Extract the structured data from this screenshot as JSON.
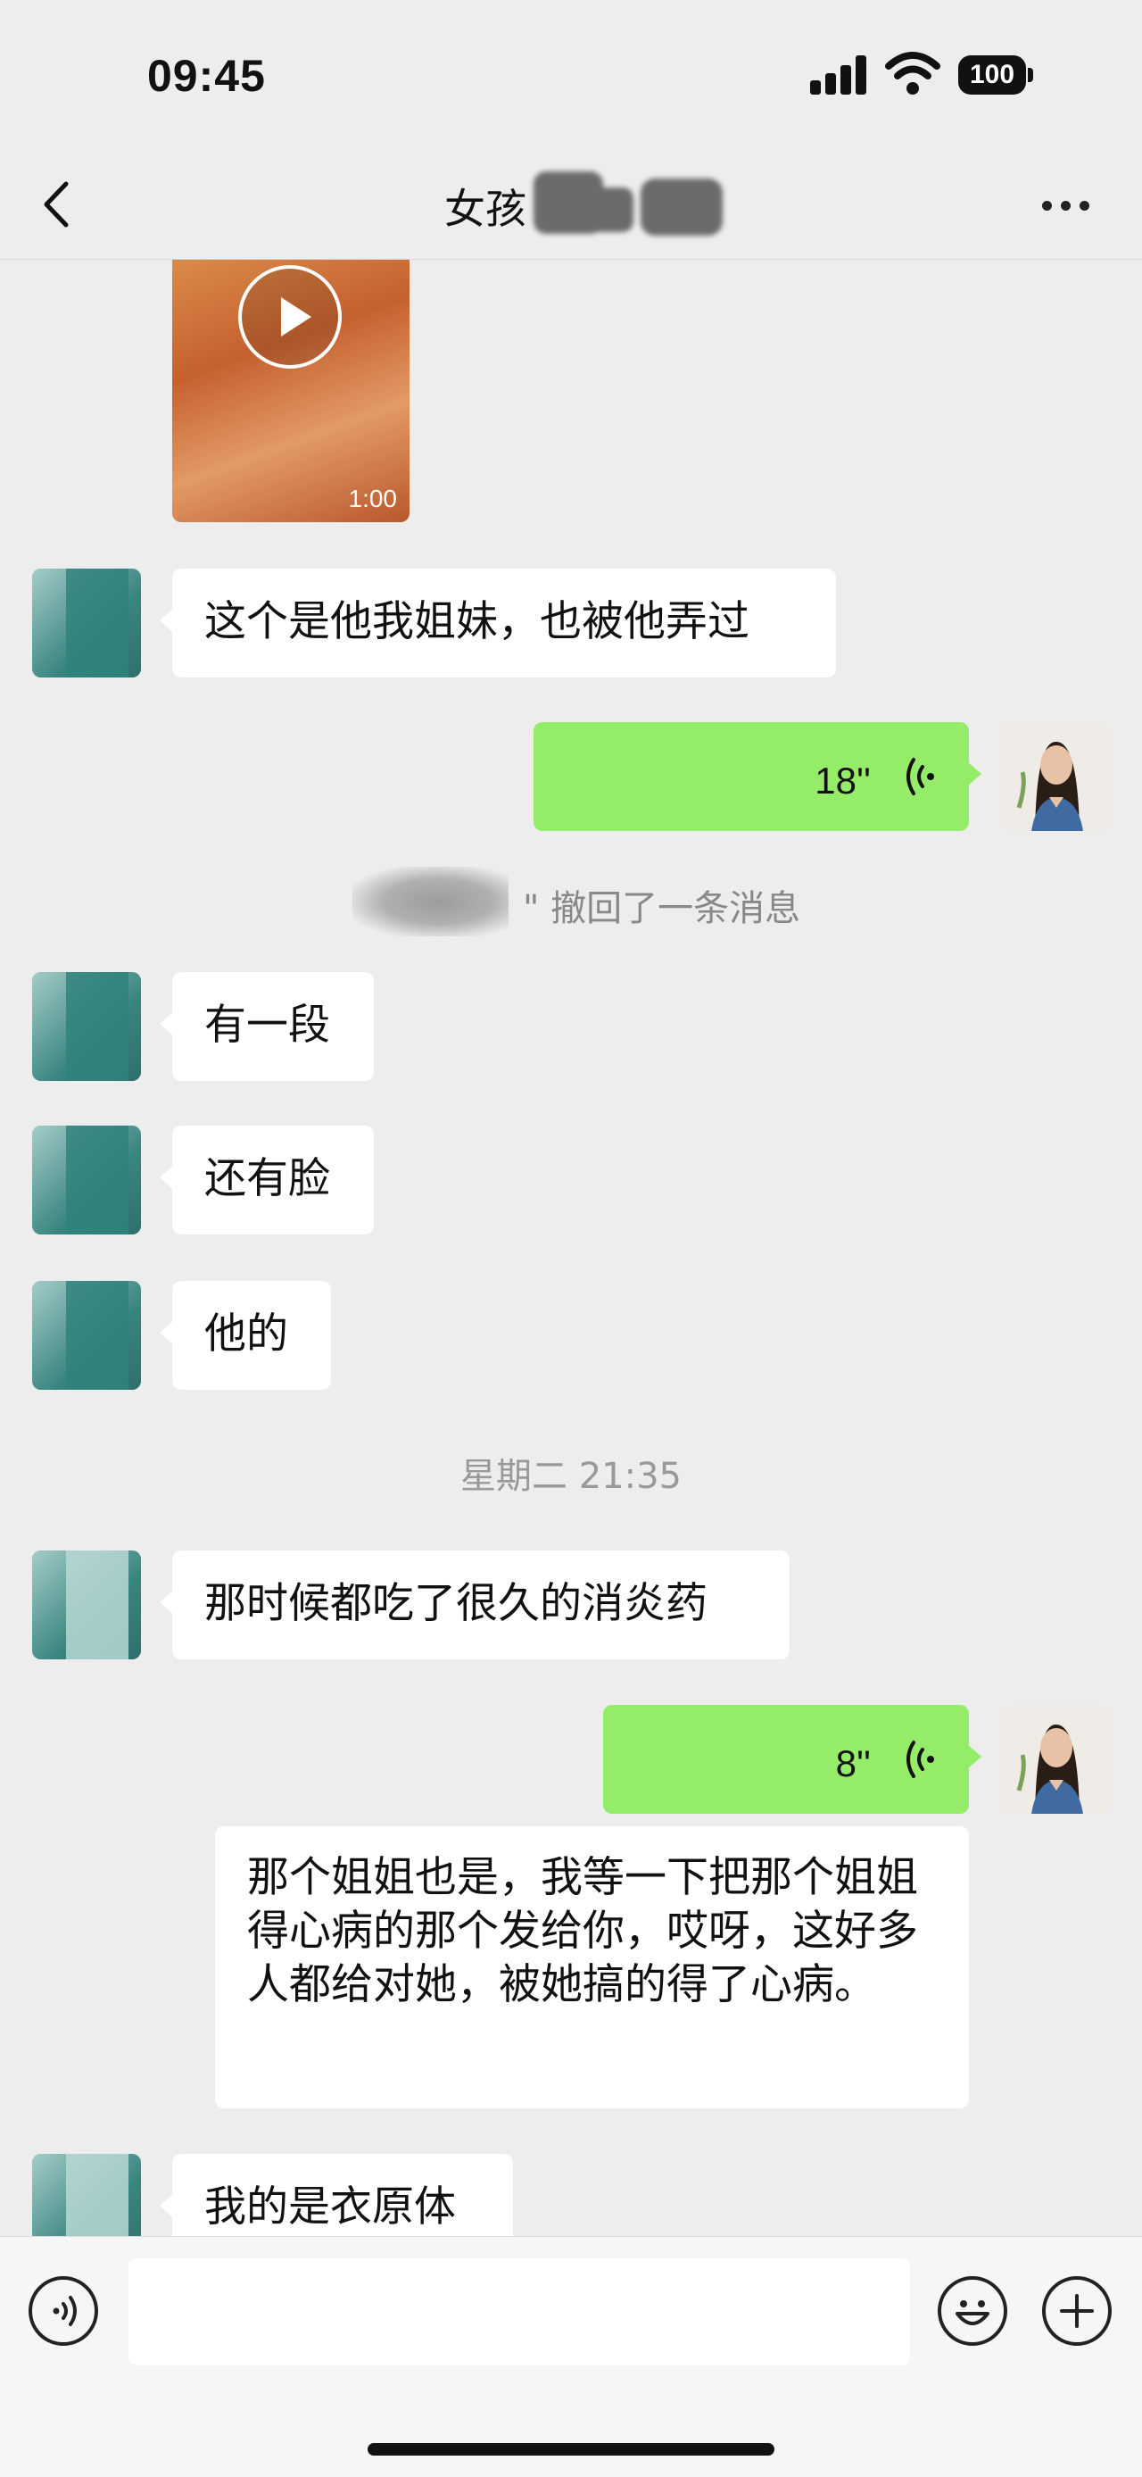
{
  "status_bar": {
    "time": "09:45",
    "battery": "100"
  },
  "header": {
    "title": "女孩"
  },
  "messages": {
    "video_duration": "1:00",
    "m1": "这个是他我姐妹，也被他弄过",
    "voice1_duration": "18''",
    "recall_notice": "\" 撤回了一条消息",
    "m2": "有一段",
    "m3": "还有脸",
    "m4": "他的",
    "time_divider": "星期二 21:35",
    "m5": "那时候都吃了很久的消炎药",
    "voice2_duration": "8''",
    "m6": "那个姐姐也是，我等一下把那个姐姐得心病的那个发给你，哎呀，这好多人都给对她，被她搞的得了心病。",
    "m7": "我的是衣原体"
  },
  "colors": {
    "background": "#ededed",
    "sent_bubble": "#95ec69",
    "received_bubble": "#ffffff"
  },
  "icons": [
    "back-chevron-icon",
    "more-dots-icon",
    "play-icon",
    "voice-wave-icon",
    "voice-input-icon",
    "emoji-icon",
    "plus-icon"
  ]
}
